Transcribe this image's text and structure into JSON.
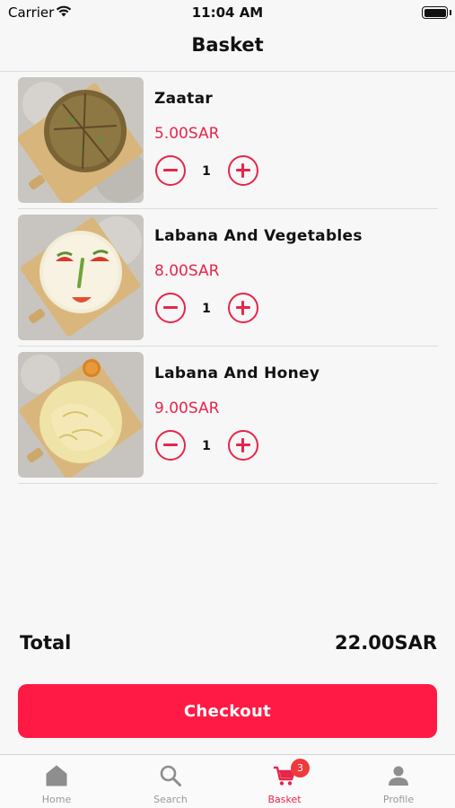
{
  "status_bar": {
    "carrier": "Carrier",
    "time": "11:04 AM"
  },
  "header": {
    "title": "Basket"
  },
  "basket": {
    "items": [
      {
        "name": "Zaatar",
        "price": "5.00SAR",
        "quantity": "1",
        "image_icon": "zaatar-flatbread-photo"
      },
      {
        "name": "Labana And Vegetables",
        "price": "8.00SAR",
        "quantity": "1",
        "image_icon": "labana-vegetables-photo"
      },
      {
        "name": "Labana And Honey",
        "price": "9.00SAR",
        "quantity": "1",
        "image_icon": "labana-honey-photo"
      }
    ]
  },
  "summary": {
    "total_label": "Total",
    "total_value": "22.00SAR"
  },
  "checkout": {
    "label": "Checkout"
  },
  "tab_bar": {
    "tabs": [
      {
        "label": "Home",
        "icon": "home-icon"
      },
      {
        "label": "Search",
        "icon": "search-icon"
      },
      {
        "label": "Basket",
        "icon": "cart-icon",
        "badge": "3"
      },
      {
        "label": "Profile",
        "icon": "person-icon"
      }
    ],
    "active_tab": "Basket"
  },
  "colors": {
    "accent": "#e8254a",
    "checkout": "#ff1a45",
    "badge": "#f0393d",
    "inactive": "#999999"
  }
}
